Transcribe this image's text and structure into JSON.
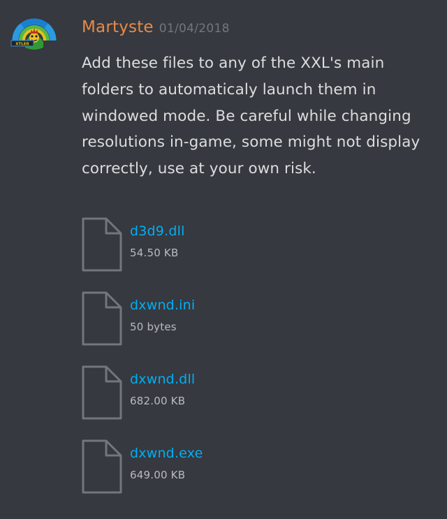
{
  "message": {
    "username": "Martyste",
    "timestamp": "01/04/2018",
    "text": "Add these files to any of the XXL's main folders to automaticaly launch them in windowed mode. Be careful while changing resolutions in-game, some might not display correctly, use at your own risk.",
    "avatar_text": "XTLER"
  },
  "attachments": [
    {
      "name": "d3d9.dll",
      "size": "54.50 KB",
      "icon": "file-icon"
    },
    {
      "name": "dxwnd.ini",
      "size": "50 bytes",
      "icon": "file-icon"
    },
    {
      "name": "dxwnd.dll",
      "size": "682.00 KB",
      "icon": "file-icon"
    },
    {
      "name": "dxwnd.exe",
      "size": "649.00 KB",
      "icon": "file-icon"
    }
  ],
  "colors": {
    "background": "#36393f",
    "username": "#e88a48",
    "timestamp": "#72767d",
    "text": "#dcddde",
    "link": "#00aff4",
    "file_size": "#b9bbbe",
    "file_icon_stroke": "#72767d"
  }
}
